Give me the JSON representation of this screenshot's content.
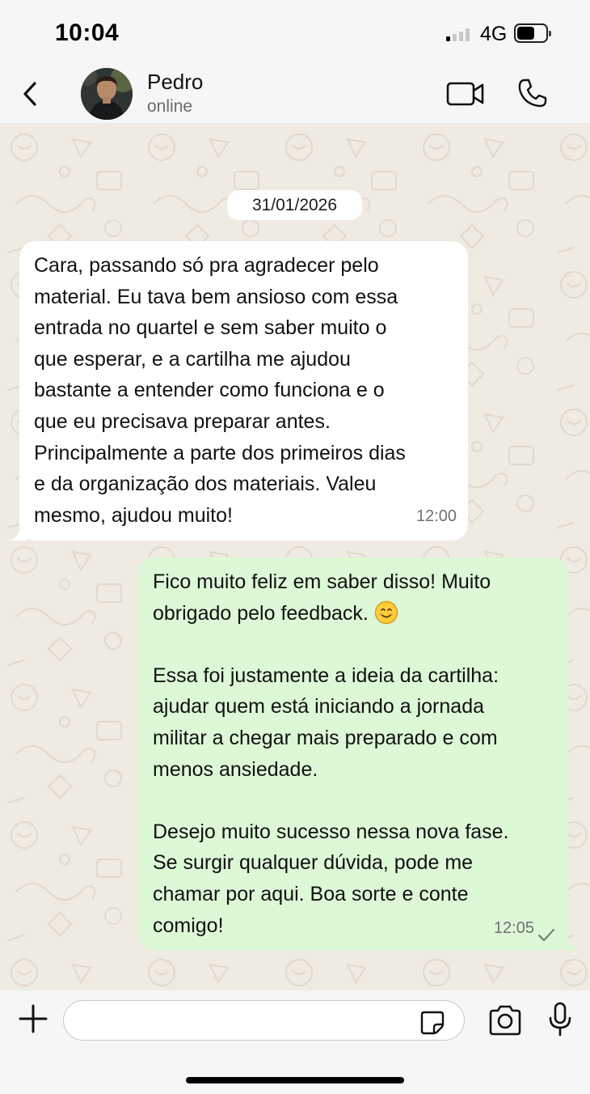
{
  "status_bar": {
    "time": "10:04",
    "network": "4G",
    "signal_bars_active": 1,
    "battery_level": 0.5
  },
  "header": {
    "contact_name": "Pedro",
    "contact_status": "online",
    "icons": [
      "back-chevron-icon",
      "video-call-icon",
      "phone-call-icon"
    ]
  },
  "chat": {
    "date_separator": "31/01/2026",
    "messages": [
      {
        "direction": "incoming",
        "text": "Cara, passando só pra agradecer pelo\nmaterial. Eu tava bem ansioso com essa\nentrada no quartel e sem saber muito o\nque esperar, e a cartilha me ajudou\nbastante a entender como funciona e o\nque eu precisava preparar antes.\nPrincipalmente a parte dos primeiros dias\ne da organização dos materiais. Valeu\nmesmo, ajudou muito!",
        "time": "12:00"
      },
      {
        "direction": "outgoing",
        "text_line1": "Fico muito feliz em saber disso! Muito",
        "text_line2": "obrigado pelo feedback. ",
        "text_rest": "\n\nEssa foi justamente a ideia da cartilha:\najudar quem está iniciando a jornada\nmilitar a chegar mais preparado e com\nmenos ansiedade.\n\nDesejo muito sucesso nessa nova fase.\nSe surgir qualquer dúvida, pode me\nchamar por aqui. Boa sorte e conte\ncomigo!",
        "emoji": "smiling-face-icon",
        "time": "12:05",
        "status": "sent"
      }
    ]
  },
  "composer": {
    "placeholder": "",
    "icons": [
      "plus-icon",
      "sticker-icon",
      "camera-icon",
      "microphone-icon"
    ]
  },
  "colors": {
    "chat_background": "#efeae2",
    "incoming_bubble": "#ffffff",
    "outgoing_bubble": "#dcf8d6",
    "bar_background": "#f6f6f6"
  }
}
